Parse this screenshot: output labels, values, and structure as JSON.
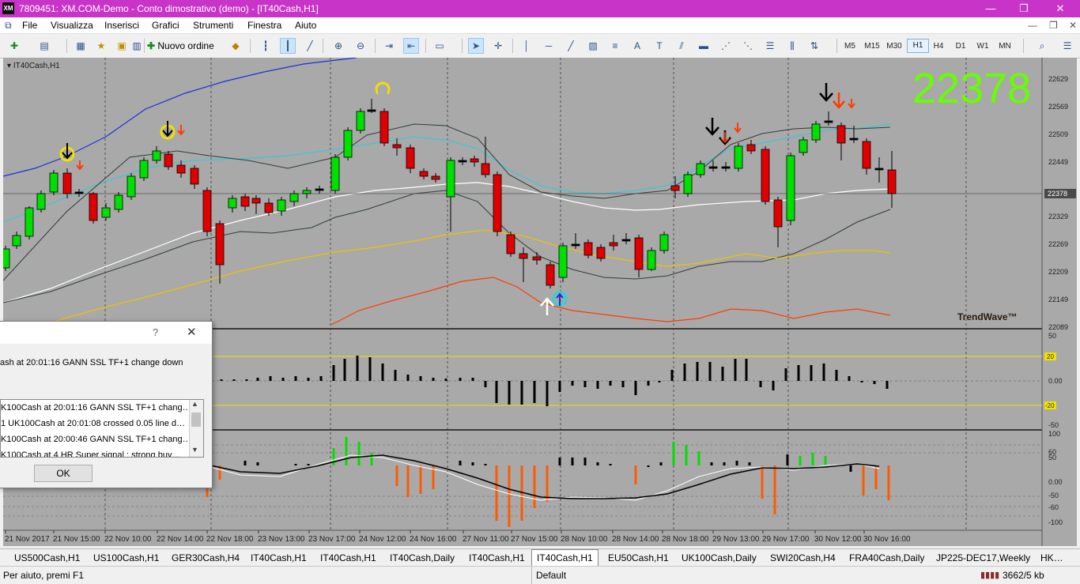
{
  "window": {
    "title": "7809451: XM.COM-Demo - Conto dimostrativo (demo) - [IT40Cash,H1]",
    "logo": "XM"
  },
  "menu": [
    "File",
    "Visualizza",
    "Inserisci",
    "Grafici",
    "Strumenti",
    "Finestra",
    "Aiuto"
  ],
  "toolbar": {
    "new_order": "Nuovo ordine",
    "timeframes": [
      "M5",
      "M15",
      "M30",
      "H1",
      "H4",
      "D1",
      "W1",
      "MN"
    ],
    "active_timeframe": "H1"
  },
  "chart": {
    "label": "IT40Cash,H1",
    "big_price": "22378",
    "brand": "TrendWave™",
    "current_price": "22378",
    "price_axis": [
      "22629",
      "22569",
      "22509",
      "22449",
      "22378",
      "22329",
      "22269",
      "22209",
      "22149",
      "22089"
    ],
    "osc1_axis": [
      "50",
      "20",
      "0.00",
      "-20",
      "-50"
    ],
    "osc1_marks": [
      "20",
      "-20"
    ],
    "osc2_axis": [
      "100",
      "60",
      "50",
      "0.00",
      "-50",
      "-60",
      "-100"
    ],
    "time_axis": [
      "21 Nov 2017",
      "21 Nov 15:00",
      "22 Nov 10:00",
      "22 Nov 14:00",
      "22 Nov 18:00",
      "23 Nov 13:00",
      "23 Nov 17:00",
      "24 Nov 12:00",
      "24 Nov 16:00",
      "27 Nov 11:00",
      "27 Nov 15:00",
      "28 Nov 10:00",
      "28 Nov 14:00",
      "28 Nov 18:00",
      "29 Nov 13:00",
      "29 Nov 17:00",
      "30 Nov 12:00",
      "30 Nov 16:00"
    ],
    "colors": {
      "bg": "#a9a9a9",
      "bull": "#00e000",
      "bear": "#e00000",
      "upper_band": "#1f2fd8",
      "cyan_line": "#3ec6d6",
      "white_line": "#ffffff",
      "yellow_line": "#f0c000",
      "red_line": "#ff3c00",
      "big_price": "#66ff00"
    }
  },
  "dialog": {
    "help": "?",
    "close": "✕",
    "message": "ash  at 20:01:16 GANN SSL TF+1 change down",
    "items": [
      "K100Cash  at 20:01:16 GANN SSL TF+1 chang…",
      "1 UK100Cash at 20:01:08 crossed 0.05 line d…",
      "K100Cash  at 20:00:46 GANN SSL TF+1 chang…",
      "K100Cash at 4 HR Super signal : strong buy…"
    ],
    "ok": "OK"
  },
  "tabs": [
    "US500Cash,H1",
    "US100Cash,H1",
    "GER30Cash,H4",
    "IT40Cash,H1",
    "IT40Cash,H1",
    "IT40Cash,Daily",
    "IT40Cash,H1",
    "IT40Cash,H1",
    "EU50Cash,H1",
    "UK100Cash,Daily",
    "SWI20Cash,H4",
    "FRA40Cash,Daily",
    "JP225-DEC17,Weekly",
    "HK…"
  ],
  "active_tab": 7,
  "status": {
    "help": "Per aiuto, premi F1",
    "profile": "Default",
    "traffic": "3662/5 kb"
  }
}
